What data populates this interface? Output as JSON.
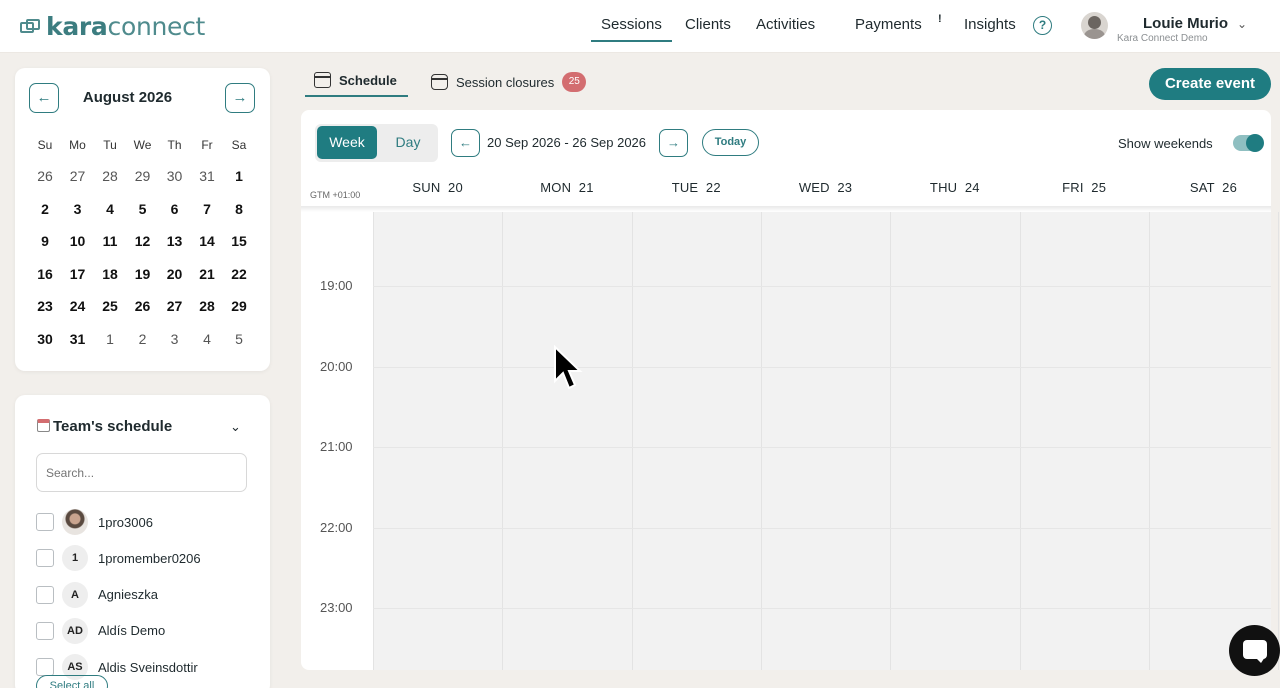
{
  "brand": {
    "logo_text_bold": "kara",
    "logo_text": "connect"
  },
  "nav": {
    "items": [
      "Sessions",
      "Clients",
      "Activities",
      "Payments",
      "Insights"
    ],
    "payments_badge": "!",
    "help_icon": "?"
  },
  "user": {
    "name": "Louie Murio",
    "org": "Kara Connect Demo"
  },
  "mini_calendar": {
    "title": "August 2026",
    "prev": "←",
    "next": "→",
    "weekdays": [
      "Su",
      "Mo",
      "Tu",
      "We",
      "Th",
      "Fr",
      "Sa"
    ],
    "weeks": [
      [
        "26",
        "27",
        "28",
        "29",
        "30",
        "31",
        "1"
      ],
      [
        "2",
        "3",
        "4",
        "5",
        "6",
        "7",
        "8"
      ],
      [
        "9",
        "10",
        "11",
        "12",
        "13",
        "14",
        "15"
      ],
      [
        "16",
        "17",
        "18",
        "19",
        "20",
        "21",
        "22"
      ],
      [
        "23",
        "24",
        "25",
        "26",
        "27",
        "28",
        "29"
      ],
      [
        "30",
        "31",
        "1",
        "2",
        "3",
        "4",
        "5"
      ]
    ]
  },
  "team": {
    "title": "Team's schedule",
    "search_placeholder": "Search...",
    "members": [
      {
        "initials": "",
        "name": "1pro3006"
      },
      {
        "initials": "1",
        "name": "1promember0206"
      },
      {
        "initials": "A",
        "name": "Agnieszka"
      },
      {
        "initials": "AD",
        "name": "Aldís Demo"
      },
      {
        "initials": "AS",
        "name": "Aldis Sveinsdottir"
      }
    ],
    "select_all": "Select all"
  },
  "tabs": {
    "schedule": "Schedule",
    "closures": "Session closures",
    "closures_count": "25"
  },
  "create_event": "Create event",
  "toolbar": {
    "week": "Week",
    "day": "Day",
    "prev": "←",
    "next": "→",
    "range": "20 Sep 2026 - 26 Sep 2026",
    "today": "Today",
    "show_weekends": "Show weekends",
    "show_weekends_on": true
  },
  "timezone": "GTM +01:00",
  "days": [
    {
      "dow": "SUN",
      "date": "20"
    },
    {
      "dow": "MON",
      "date": "21"
    },
    {
      "dow": "TUE",
      "date": "22"
    },
    {
      "dow": "WED",
      "date": "23"
    },
    {
      "dow": "THU",
      "date": "24"
    },
    {
      "dow": "FRI",
      "date": "25"
    },
    {
      "dow": "SAT",
      "date": "26"
    }
  ],
  "hours": [
    "19:00",
    "20:00",
    "21:00",
    "22:00",
    "23:00"
  ],
  "colors": {
    "accent": "#1f7c81",
    "badge": "#d36d70",
    "grid": "#f2f2f2"
  }
}
